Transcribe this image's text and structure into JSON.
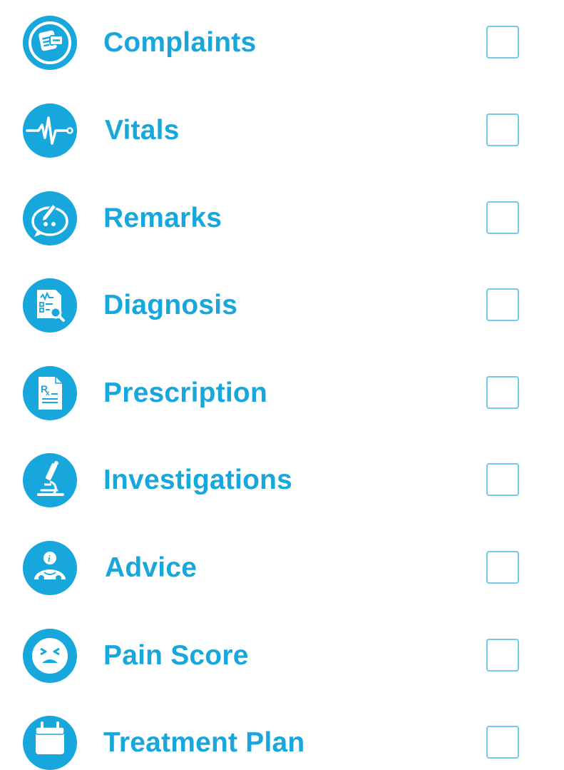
{
  "colors": {
    "accent": "#17a7dc",
    "checkbox_border": "#6fcbe9",
    "background": "#ffffff"
  },
  "items": [
    {
      "label": "Complaints",
      "icon": "complaints-chat-icon",
      "checked": false
    },
    {
      "label": "Vitals",
      "icon": "heartbeat-icon",
      "checked": false
    },
    {
      "label": "Remarks",
      "icon": "remarks-pen-bubble-icon",
      "checked": false
    },
    {
      "label": "Diagnosis",
      "icon": "diagnosis-report-search-icon",
      "checked": false
    },
    {
      "label": "Prescription",
      "icon": "prescription-rx-icon",
      "checked": false
    },
    {
      "label": "Investigations",
      "icon": "microscope-icon",
      "checked": false
    },
    {
      "label": "Advice",
      "icon": "advice-info-icon",
      "checked": false
    },
    {
      "label": "Pain Score",
      "icon": "pain-face-icon",
      "checked": false
    },
    {
      "label": "Treatment Plan",
      "icon": "calendar-icon",
      "checked": false
    }
  ]
}
